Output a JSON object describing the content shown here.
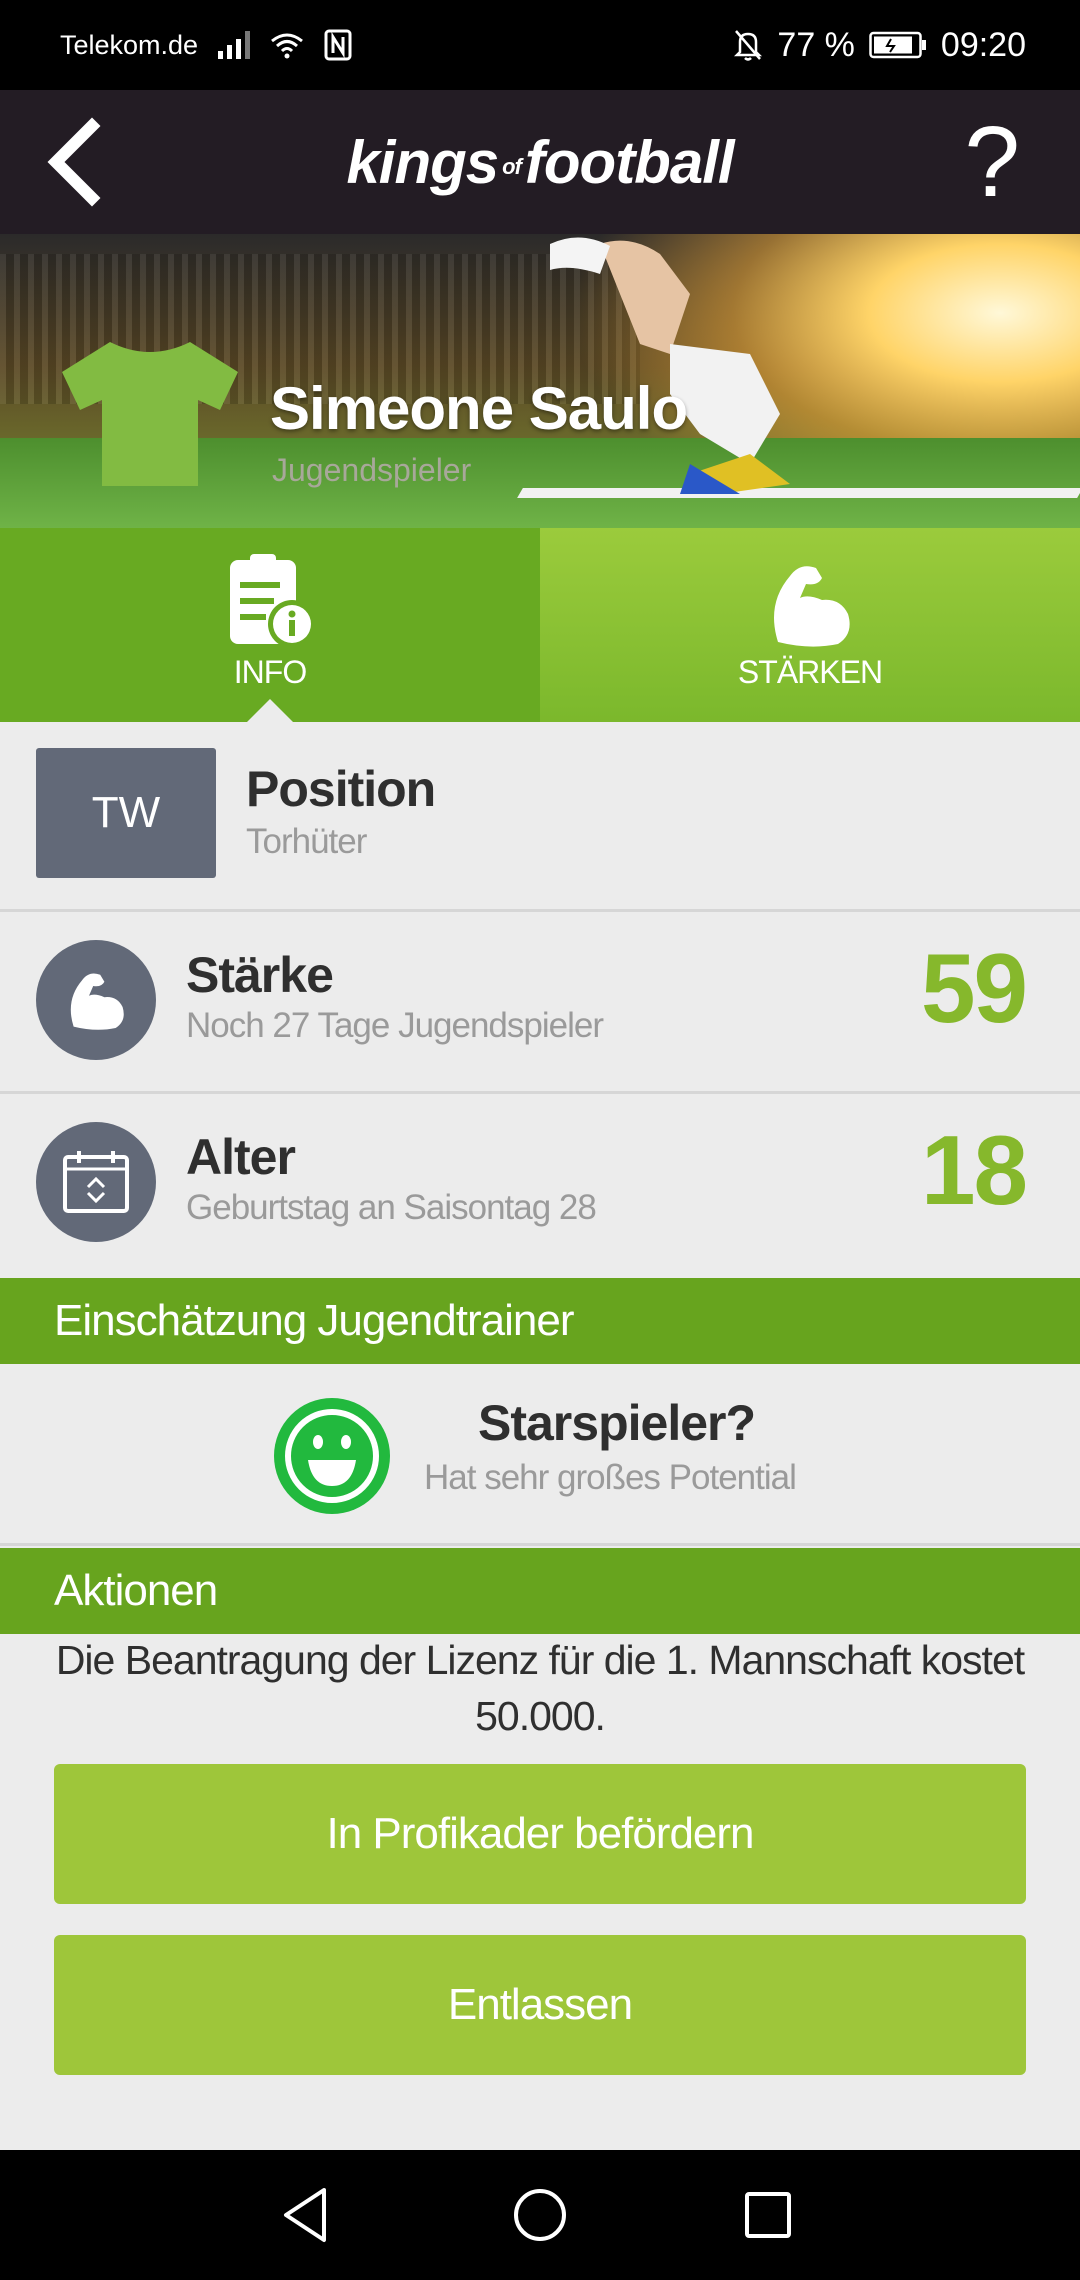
{
  "status_bar": {
    "carrier": "Telekom.de",
    "battery": "77 %",
    "time": "09:20"
  },
  "header": {
    "logo_main_1": "kings",
    "logo_of": "of",
    "logo_main_2": "football",
    "help_label": "?"
  },
  "hero": {
    "player_name": "Simeone Saulo",
    "player_status": "Jugendspieler"
  },
  "tabs": [
    {
      "label": "INFO",
      "icon": "info-document-icon",
      "active": true
    },
    {
      "label": "STÄRKEN",
      "icon": "flexed-arm-icon",
      "active": false
    }
  ],
  "info": {
    "position": {
      "badge": "TW",
      "title": "Position",
      "value": "Torhüter"
    },
    "strength": {
      "title": "Stärke",
      "subtitle": "Noch 27 Tage Jugendspieler",
      "value": "59",
      "icon": "flexed-arm-icon"
    },
    "age": {
      "title": "Alter",
      "subtitle": "Geburtstag an Saisontag 28",
      "value": "18",
      "icon": "calendar-icon"
    }
  },
  "trainer_section": {
    "header": "Einschätzung Jugendtrainer",
    "title": "Starspieler?",
    "subtitle": "Hat sehr großes Potential",
    "icon": "smiley-icon"
  },
  "actions_section": {
    "header": "Aktionen",
    "license_text": "Die Beantragung der Lizenz für die 1. Mannschaft kostet 50.000.",
    "promote_label": "In Profikader befördern",
    "dismiss_label": "Entlassen"
  },
  "colors": {
    "accent_green": "#68aa22",
    "button_green": "#9ec63a",
    "number_green": "#86b82c",
    "badge_gray": "#626978",
    "header_dark": "#231c24"
  }
}
